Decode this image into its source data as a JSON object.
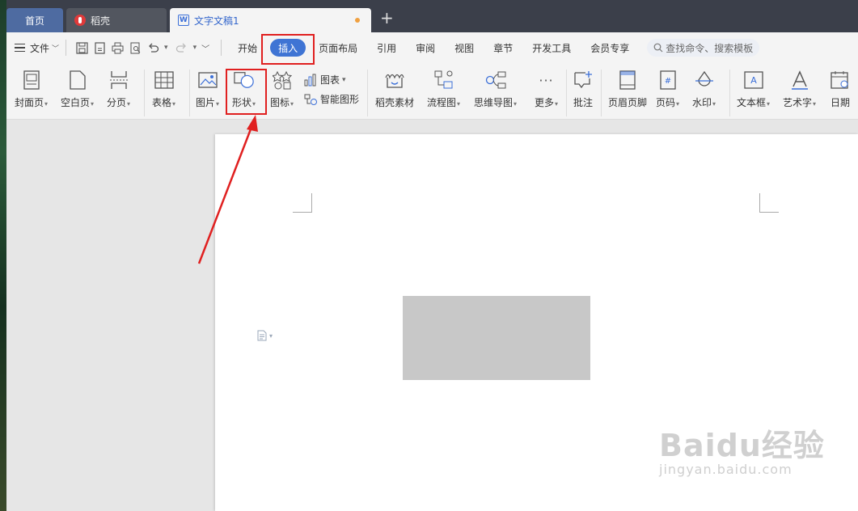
{
  "tabs": {
    "home": "首页",
    "daoke": "稻壳",
    "doc": "文字文稿1",
    "add": "+"
  },
  "menubar": {
    "file": "文件",
    "items": [
      "开始",
      "插入",
      "页面布局",
      "引用",
      "审阅",
      "视图",
      "章节",
      "开发工具",
      "会员专享"
    ],
    "search_placeholder": "查找命令、搜索模板"
  },
  "ribbon": {
    "cover": "封面页",
    "blank": "空白页",
    "pagebreak": "分页",
    "table": "表格",
    "picture": "图片",
    "shape": "形状",
    "icons": "图标",
    "chart": "图表",
    "smartart": "智能图形",
    "daoke_material": "稻壳素材",
    "flowchart": "流程图",
    "mindmap": "思维导图",
    "more": "更多",
    "comment": "批注",
    "header_footer": "页眉页脚",
    "page_number": "页码",
    "watermark": "水印",
    "textbox": "文本框",
    "wordart": "艺术字",
    "date": "日期"
  },
  "watermark": {
    "main": "Baidu经验",
    "sub": "jingyan.baidu.com"
  },
  "colors": {
    "accent": "#3f74d4",
    "highlight": "#e02020",
    "tabbar": "#3b3f4a"
  }
}
